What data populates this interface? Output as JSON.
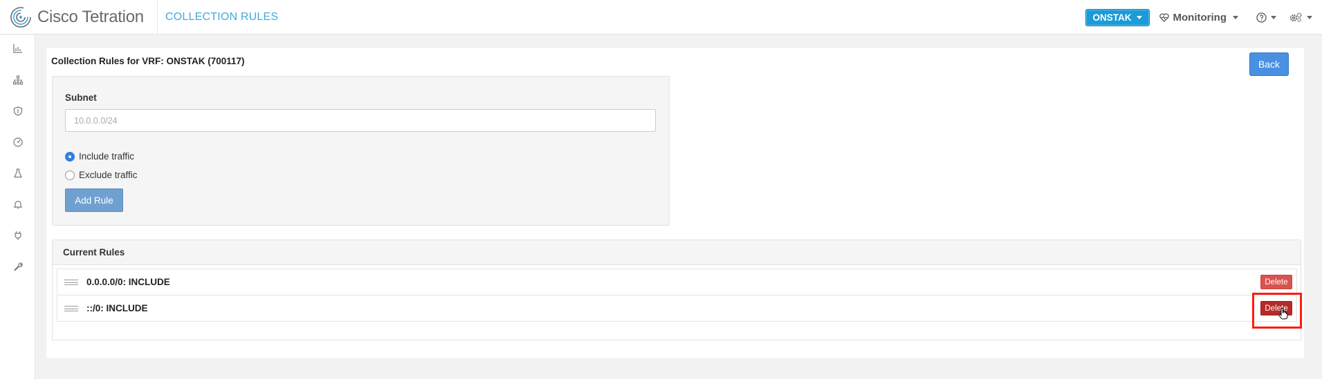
{
  "header": {
    "brand": "Cisco Tetration",
    "page_title": "COLLECTION RULES",
    "vrf_selector": "ONSTAK",
    "monitoring_label": "Monitoring"
  },
  "sidebar": {
    "icons": [
      "dashboard-icon",
      "topology-icon",
      "security-shield-icon",
      "performance-gauge-icon",
      "lab-flask-icon",
      "alerts-bell-icon",
      "connector-plug-icon",
      "maintenance-wrench-icon"
    ]
  },
  "main": {
    "title": "Collection Rules for VRF: ONSTAK (700117)",
    "back_label": "Back",
    "form": {
      "subnet_label": "Subnet",
      "subnet_placeholder": "10.0.0.0/24",
      "subnet_value": "",
      "include_label": "Include traffic",
      "exclude_label": "Exclude traffic",
      "selected_option": "include",
      "add_rule_label": "Add Rule"
    },
    "current_rules": {
      "header": "Current Rules",
      "rules": [
        {
          "text": "0.0.0.0/0: INCLUDE",
          "delete_label": "Delete"
        },
        {
          "text": "::/0: INCLUDE",
          "delete_label": "Delete"
        }
      ]
    }
  },
  "colors": {
    "accent": "#3fa9e0",
    "vrf_button": "#1b9bd7",
    "back_button": "#4a90e2",
    "add_rule_button": "#6fa0d0",
    "delete_button": "#d9534f",
    "highlight": "#ff1b0f"
  }
}
